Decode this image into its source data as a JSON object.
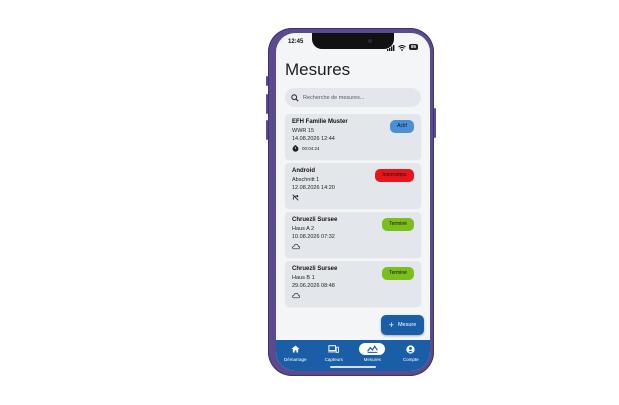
{
  "status_bar": {
    "time": "12:45",
    "battery": "85"
  },
  "page": {
    "title": "Mesures"
  },
  "search": {
    "placeholder": "Recherche de mesures..."
  },
  "measurements": [
    {
      "name": "EFH Familie Muster",
      "location": "WWR 15",
      "date": "14.08.2026 12:44",
      "meta": "00:04:24",
      "meta_icon": "timer-icon",
      "status": "Actif",
      "status_color": "#4a90d9"
    },
    {
      "name": "Android",
      "location": "Abschnitt 1",
      "date": "12.08.2026 14:20",
      "meta": "",
      "meta_icon": "no-sync-icon",
      "status": "Interrompu",
      "status_color": "#e8151b"
    },
    {
      "name": "Chruezli Sursee",
      "location": "Haus A 2",
      "date": "10.08.2026 07:32",
      "meta": "",
      "meta_icon": "cloud-icon",
      "status": "Terminé",
      "status_color": "#7cbf1c"
    },
    {
      "name": "Chruezli Sursee",
      "location": "Haus B 1",
      "date": "29.06.2026 08:48",
      "meta": "",
      "meta_icon": "cloud-icon",
      "status": "Terminé",
      "status_color": "#7cbf1c"
    }
  ],
  "fab": {
    "label": "Mesure"
  },
  "nav": [
    {
      "label": "Démarrage",
      "icon": "home-icon",
      "active": false
    },
    {
      "label": "Capteurs",
      "icon": "devices-icon",
      "active": false
    },
    {
      "label": "Mesures",
      "icon": "chart-icon",
      "active": true
    },
    {
      "label": "Compte",
      "icon": "account-icon",
      "active": false
    }
  ],
  "colors": {
    "brand": "#1a5ea8",
    "background": "#f3f5f7",
    "card": "#e3e7eb",
    "phone_frame": "#5b4a8f"
  }
}
